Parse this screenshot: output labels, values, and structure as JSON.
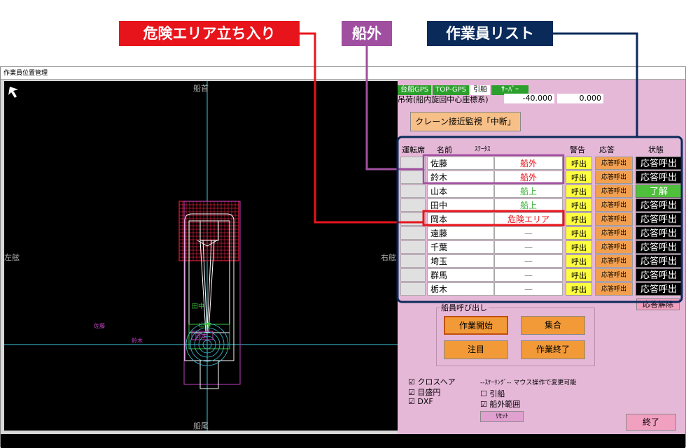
{
  "callouts": {
    "danger": "危険エリア立ち入り",
    "outside": "船外",
    "list": "作業員リスト"
  },
  "colors": {
    "danger": "#e8141c",
    "outside": "#a04fa0",
    "list": "#0a2a5a"
  },
  "window": {
    "title": "作業員位置管理"
  },
  "view": {
    "bow": "船首",
    "stern": "船尾",
    "port": "左舷",
    "starboard": "右舷",
    "labels": {
      "tanaka": "田中",
      "yamamoto": "山本",
      "okamoto": "岡本",
      "sato": "佐藤",
      "suzuki": "鈴木"
    }
  },
  "panel": {
    "gps": [
      "台船GPS",
      "TOP-GPS",
      "引船",
      "ｻｰﾊﾞｰ"
    ],
    "hook_label": "吊荷(船内旋回中心座標系)",
    "hook_x": "-40.000",
    "hook_y": "0.000",
    "crane_btn": "クレーン接近監視「中断」",
    "headers": {
      "seat": "運転席",
      "name": "名前",
      "status": "ｽﾃｰﾀｽ",
      "warn": "警告",
      "resp": "応答",
      "state": "状態"
    },
    "rows": [
      {
        "name": "佐藤",
        "status": "船外",
        "call": "呼出",
        "resp": "応答呼出",
        "state": "応答呼出",
        "statusColor": "#e8141c",
        "stateBg": "#000"
      },
      {
        "name": "鈴木",
        "status": "船外",
        "call": "呼出",
        "resp": "応答呼出",
        "state": "応答呼出",
        "statusColor": "#e8141c",
        "stateBg": "#000"
      },
      {
        "name": "山本",
        "status": "船上",
        "call": "呼出",
        "resp": "応答呼出",
        "state": "了解",
        "statusColor": "#3cb43c",
        "stateBg": "#4fc03c"
      },
      {
        "name": "田中",
        "status": "船上",
        "call": "呼出",
        "resp": "応答呼出",
        "state": "応答呼出",
        "statusColor": "#3cb43c",
        "stateBg": "#000"
      },
      {
        "name": "岡本",
        "status": "危険エリア",
        "call": "呼出",
        "resp": "応答呼出",
        "state": "応答呼出",
        "statusColor": "#e8141c",
        "stateBg": "#000"
      },
      {
        "name": "遠藤",
        "status": "—",
        "call": "呼出",
        "resp": "応答呼出",
        "state": "応答呼出",
        "statusColor": "#888",
        "stateBg": "#000"
      },
      {
        "name": "千葉",
        "status": "—",
        "call": "呼出",
        "resp": "応答呼出",
        "state": "応答呼出",
        "statusColor": "#888",
        "stateBg": "#000"
      },
      {
        "name": "埼玉",
        "status": "—",
        "call": "呼出",
        "resp": "応答呼出",
        "state": "応答呼出",
        "statusColor": "#888",
        "stateBg": "#000"
      },
      {
        "name": "群馬",
        "status": "—",
        "call": "呼出",
        "resp": "応答呼出",
        "state": "応答呼出",
        "statusColor": "#888",
        "stateBg": "#000"
      },
      {
        "name": "栃木",
        "status": "—",
        "call": "呼出",
        "resp": "応答呼出",
        "state": "応答呼出",
        "statusColor": "#888",
        "stateBg": "#000"
      }
    ],
    "resp_clear": "応答解除",
    "crew_call": "船員呼び出し",
    "btn_start": "作業開始",
    "btn_gather": "集合",
    "btn_attention": "注目",
    "btn_end_work": "作業終了",
    "chk_crosshair": "クロスヘア",
    "chk_scale": "目盛円",
    "chk_dxf": "DXF",
    "scaling_note": "--ｽｹｰﾘﾝｸﾞ-- マウス操作で変更可能",
    "chk_tug": "引船",
    "chk_outside": "船外範囲",
    "reset": "ﾘｾｯﾄ",
    "quit": "終了"
  }
}
